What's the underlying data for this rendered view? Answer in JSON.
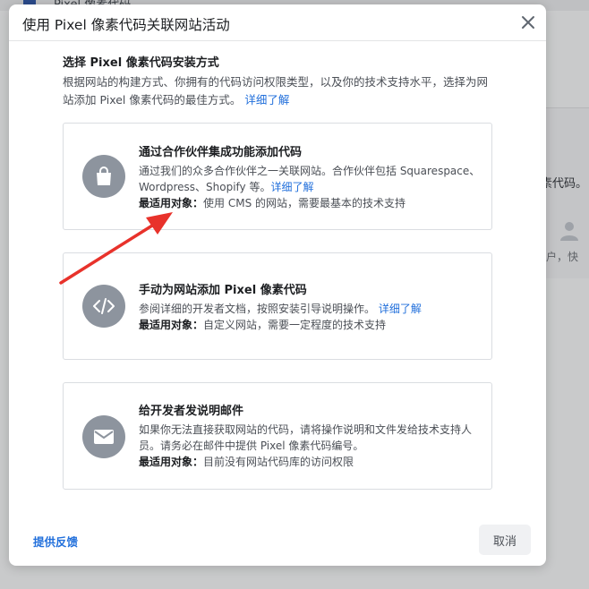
{
  "background": {
    "title": "Pixel 像素代码",
    "card_text": "素代码。",
    "card_text2": "户，快"
  },
  "dialog": {
    "title": "使用 Pixel 像素代码关联网站活动",
    "section_title": "选择 Pixel 像素代码安装方式",
    "section_desc": "根据网站的构建方式、你拥有的代码访问权限类型，以及你的技术支持水平，选择为网站添加 Pixel 像素代码的最佳方式。",
    "section_link": "详细了解",
    "options": [
      {
        "icon": "shopping-bag-icon",
        "title": "通过合作伙伴集成功能添加代码",
        "desc": "通过我们的众多合作伙伴之一关联网站。合作伙伴包括 Squarespace、Wordpress、Shopify 等。",
        "link": "详细了解",
        "best_label": "最适用对象：",
        "best_value": "使用 CMS 的网站，需要最基本的技术支持"
      },
      {
        "icon": "code-icon",
        "title": "手动为网站添加 Pixel 像素代码",
        "desc": "参阅详细的开发者文档，按照安装引导说明操作。",
        "link": "详细了解",
        "best_label": "最适用对象：",
        "best_value": "自定义网站，需要一定程度的技术支持"
      },
      {
        "icon": "envelope-icon",
        "title": "给开发者发说明邮件",
        "desc": "如果你无法直接获取网站的代码，请将操作说明和文件发给技术支持人员。请务必在邮件中提供 Pixel 像素代码编号。",
        "link": "",
        "best_label": "最适用对象：",
        "best_value": "目前没有网站代码库的访问权限"
      }
    ],
    "feedback_label": "提供反馈",
    "cancel_label": "取消"
  },
  "colors": {
    "accent": "#216fdb",
    "icon_bg": "#8d949e",
    "annotation_arrow": "#e8322b"
  }
}
